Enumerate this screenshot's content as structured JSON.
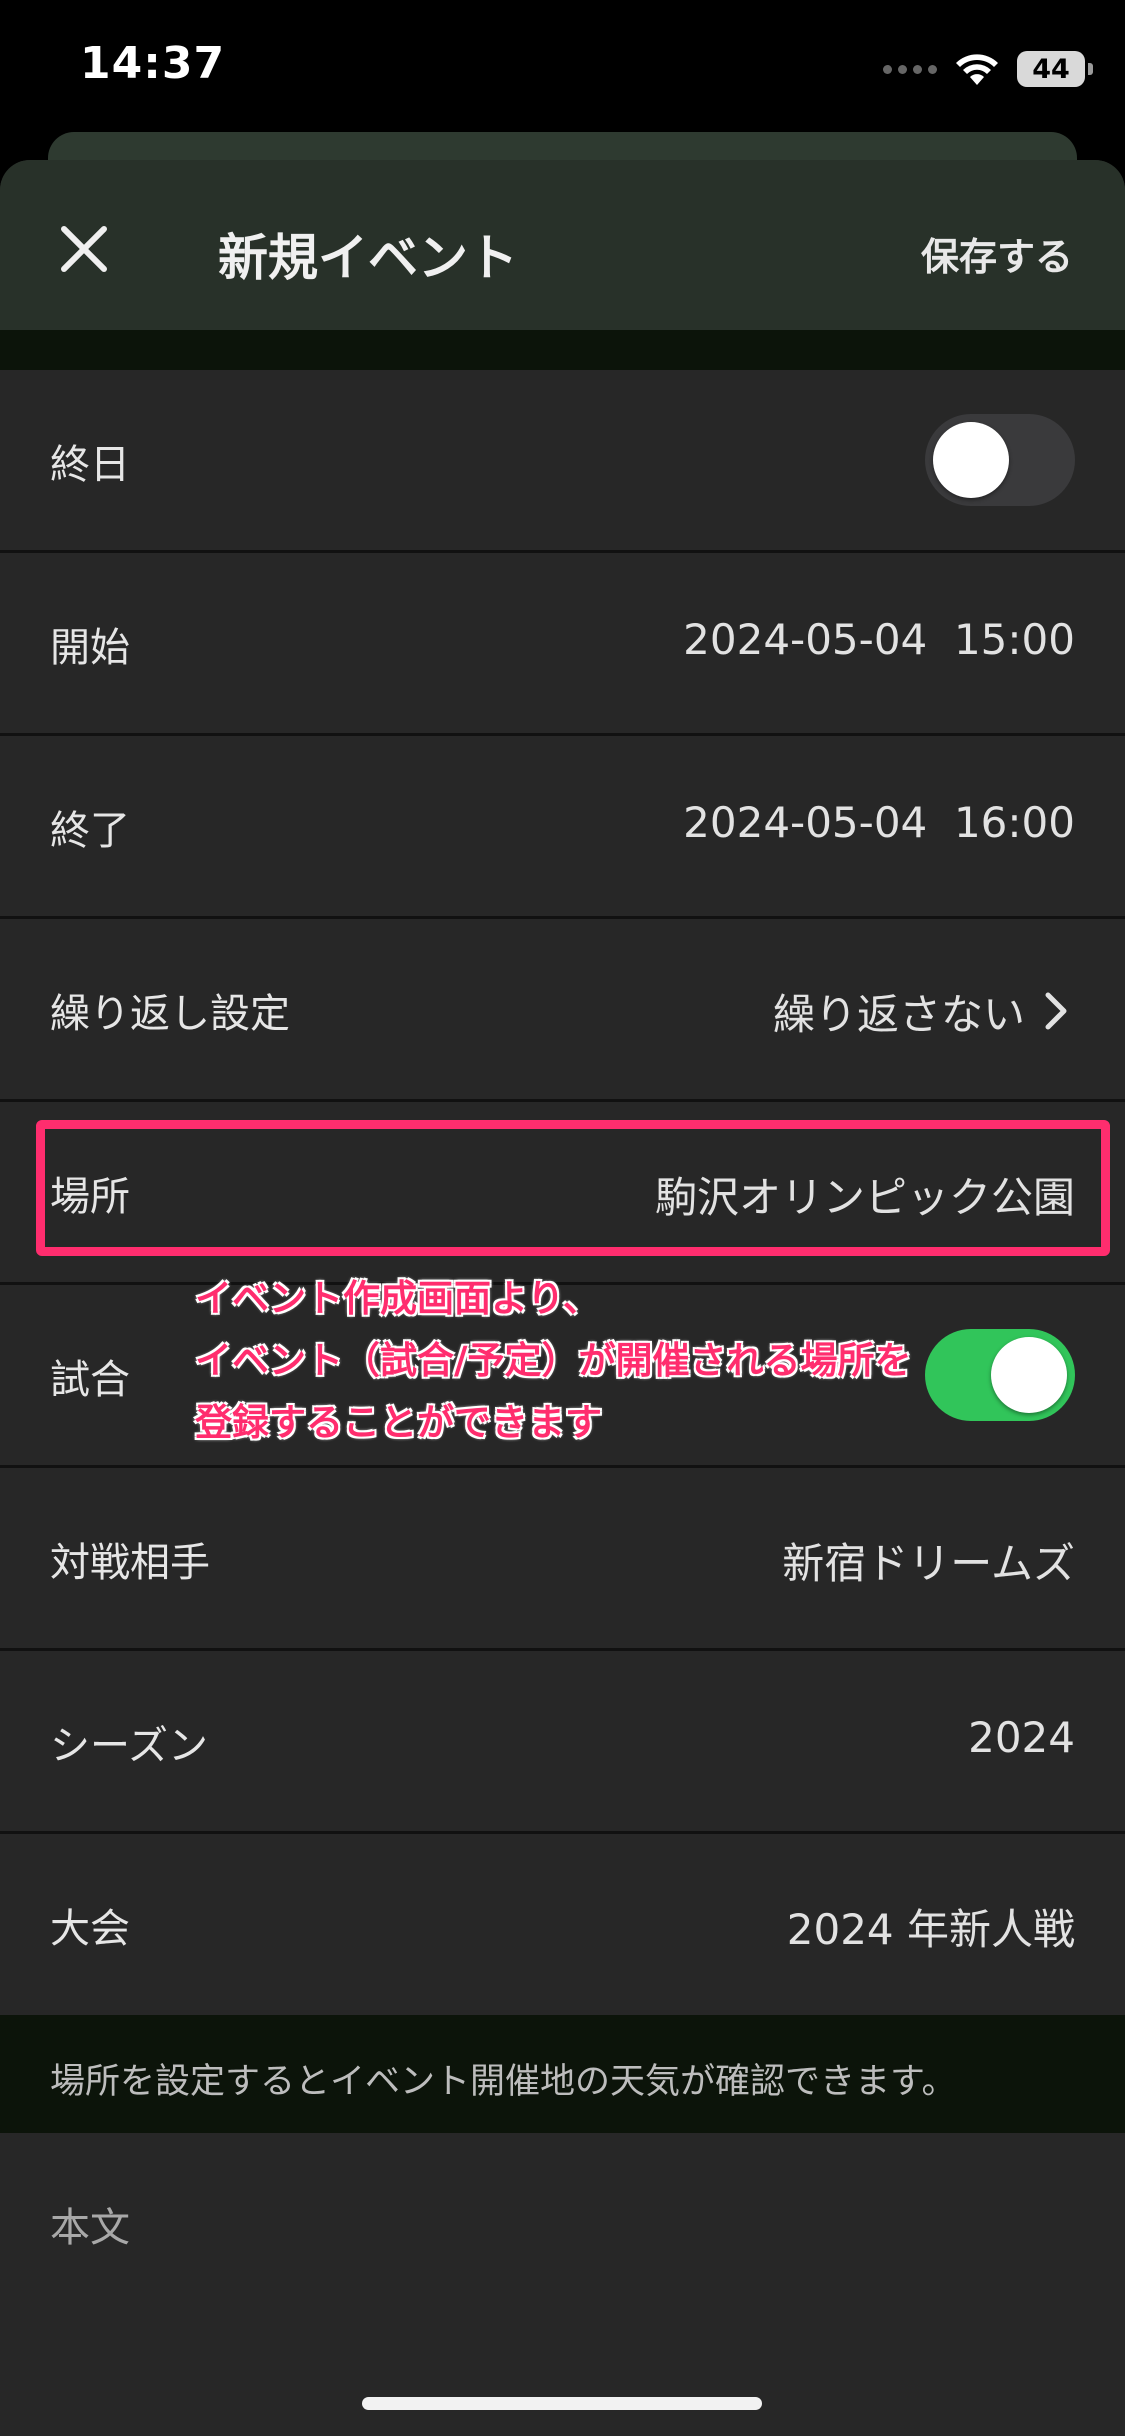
{
  "status_bar": {
    "time": "14:37",
    "battery": "44"
  },
  "nav": {
    "title": "新規イベント",
    "save_label": "保存する"
  },
  "rows": {
    "all_day": {
      "label": "終日",
      "toggle_on": false
    },
    "start": {
      "label": "開始",
      "value": "2024-05-04  15:00"
    },
    "end": {
      "label": "終了",
      "value": "2024-05-04  16:00"
    },
    "repeat": {
      "label": "繰り返し設定",
      "value": "繰り返さない"
    },
    "location": {
      "label": "場所",
      "value": "駒沢オリンピック公園"
    },
    "match": {
      "label": "試合",
      "toggle_on": true
    },
    "opponent": {
      "label": "対戦相手",
      "value": "新宿ドリームズ"
    },
    "season": {
      "label": "シーズン",
      "value": "2024"
    },
    "tournament": {
      "label": "大会",
      "value": "2024 年新人戦"
    }
  },
  "annotation": {
    "line1": "イベント作成画面より、",
    "line2": "イベント（試合/予定）が開催される場所を",
    "line3": "登録することができます"
  },
  "footer_note": "場所を設定するとイベント開催地の天気が確認できます。",
  "body": {
    "placeholder": "本文"
  },
  "colors": {
    "accent_green": "#31c55a",
    "highlight_pink": "#ff2d6e",
    "header_bg": "#283129"
  }
}
